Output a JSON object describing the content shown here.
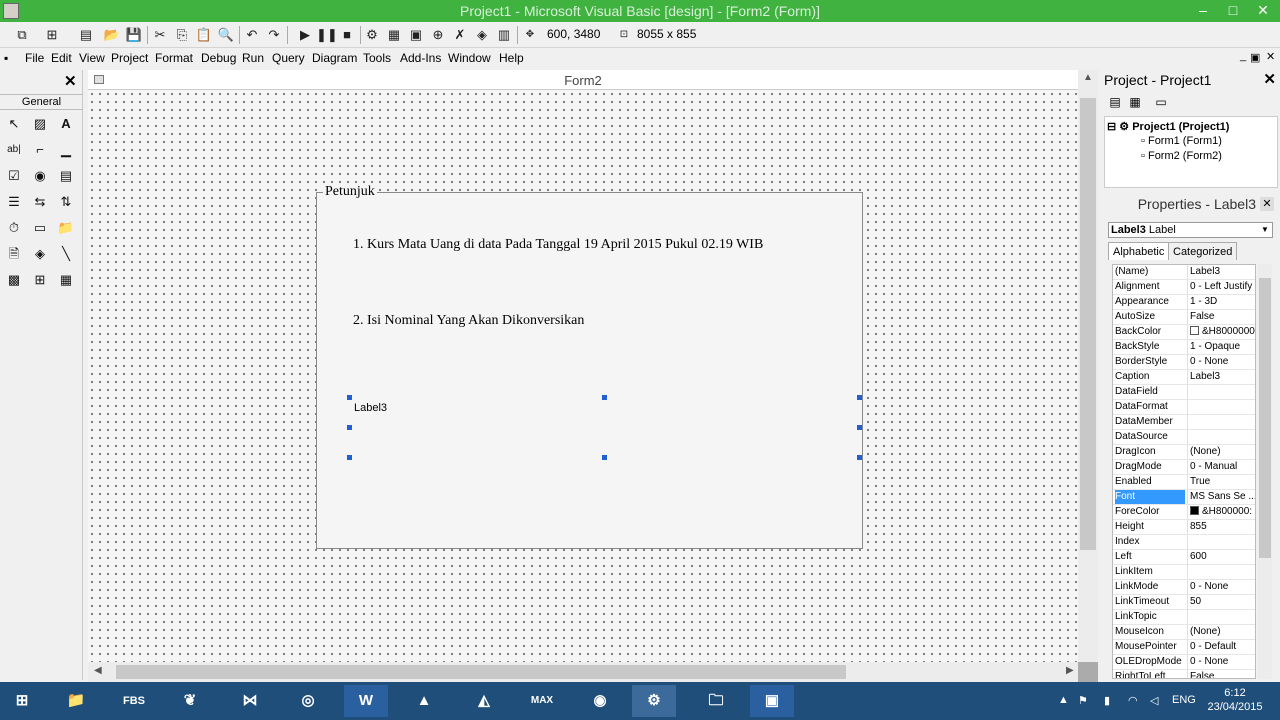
{
  "window": {
    "title": "Project1 - Microsoft Visual Basic [design] - [Form2 (Form)]"
  },
  "toolbar": {
    "position": "600, 3480",
    "size": "8055 x 855"
  },
  "menu": [
    "File",
    "Edit",
    "View",
    "Project",
    "Format",
    "Debug",
    "Run",
    "Query",
    "Diagram",
    "Tools",
    "Add-Ins",
    "Window",
    "Help"
  ],
  "toolbox": {
    "tab": "General"
  },
  "form": {
    "title": "Form2",
    "frame_caption": "Petunjuk",
    "label1": "1. Kurs Mata Uang di data Pada Tanggal 19 April 2015 Pukul 02.19 WIB",
    "label2": "2. Isi Nominal Yang Akan Dikonversikan",
    "label3": "Label3"
  },
  "project": {
    "title": "Project - Project1",
    "tree": [
      "Project1 (Project1)",
      "Form1 (Form1)",
      "Form2 (Form2)"
    ]
  },
  "properties": {
    "title": "Properties - Label3",
    "object_name": "Label3",
    "object_type": "Label",
    "tabs": [
      "Alphabetic",
      "Categorized"
    ],
    "selected": "Font",
    "rows": [
      {
        "k": "(Name)",
        "v": "Label3"
      },
      {
        "k": "Alignment",
        "v": "0 - Left Justify"
      },
      {
        "k": "Appearance",
        "v": "1 - 3D"
      },
      {
        "k": "AutoSize",
        "v": "False"
      },
      {
        "k": "BackColor",
        "v": "&H8000000",
        "swatch": "#ffffff"
      },
      {
        "k": "BackStyle",
        "v": "1 - Opaque"
      },
      {
        "k": "BorderStyle",
        "v": "0 - None"
      },
      {
        "k": "Caption",
        "v": "Label3"
      },
      {
        "k": "DataField",
        "v": ""
      },
      {
        "k": "DataFormat",
        "v": ""
      },
      {
        "k": "DataMember",
        "v": ""
      },
      {
        "k": "DataSource",
        "v": ""
      },
      {
        "k": "DragIcon",
        "v": "(None)"
      },
      {
        "k": "DragMode",
        "v": "0 - Manual"
      },
      {
        "k": "Enabled",
        "v": "True"
      },
      {
        "k": "Font",
        "v": "MS Sans Se ..."
      },
      {
        "k": "ForeColor",
        "v": "&H800000:",
        "swatch": "#000000"
      },
      {
        "k": "Height",
        "v": "855"
      },
      {
        "k": "Index",
        "v": ""
      },
      {
        "k": "Left",
        "v": "600"
      },
      {
        "k": "LinkItem",
        "v": ""
      },
      {
        "k": "LinkMode",
        "v": "0 - None"
      },
      {
        "k": "LinkTimeout",
        "v": "50"
      },
      {
        "k": "LinkTopic",
        "v": ""
      },
      {
        "k": "MouseIcon",
        "v": "(None)"
      },
      {
        "k": "MousePointer",
        "v": "0 - Default"
      },
      {
        "k": "OLEDropMode",
        "v": "0 - None"
      },
      {
        "k": "RightToLeft",
        "v": "False"
      }
    ]
  },
  "taskbar": {
    "apps": [
      "windows-start",
      "file-explorer",
      "FBS",
      "app-leaf",
      "visual-studio",
      "chrome",
      "word",
      "app-triangle",
      "matlab",
      "max",
      "firefox",
      "vb6",
      "explorer",
      "app-blue"
    ],
    "tray_lang": "ENG",
    "time": "6:12",
    "date": "23/04/2015"
  }
}
